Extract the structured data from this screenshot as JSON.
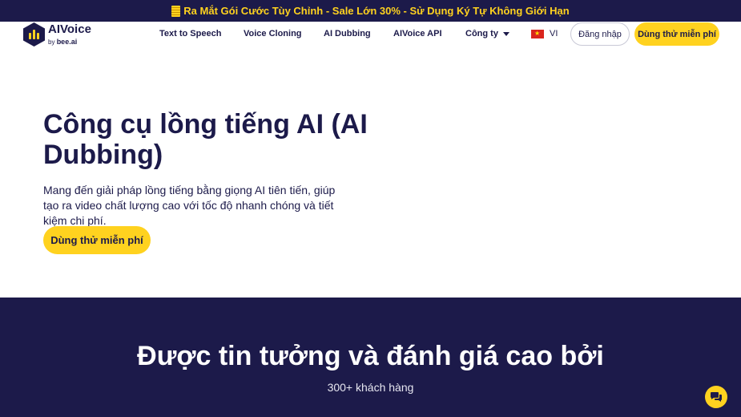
{
  "promo": {
    "text": "Ra Mắt Gói Cước Tùy Chỉnh - Sale Lớn 30% - Sử Dụng Ký Tự Không Giới Hạn"
  },
  "header": {
    "logo": {
      "brand": "AIVoice",
      "by": "by",
      "partner": "bee.ai"
    },
    "nav": [
      {
        "label": "Text to Speech"
      },
      {
        "label": "Voice Cloning"
      },
      {
        "label": "AI Dubbing"
      },
      {
        "label": "AIVoice API"
      },
      {
        "label": "Công ty"
      }
    ],
    "language": "VI",
    "login_label": "Đăng nhập",
    "try_label": "Dùng thử miễn phí"
  },
  "hero": {
    "title": "Công cụ lồng tiếng AI (AI Dubbing)",
    "description": "Mang đến giải pháp lồng tiếng bằng giọng AI tiên tiến, giúp tạo ra video chất lượng cao với tốc độ nhanh chóng và tiết kiệm chi phí.",
    "cta_label": "Dùng thử miễn phí"
  },
  "trust": {
    "heading": "Được tin tưởng và đánh giá cao bởi",
    "subheading": "300+ khách hàng"
  },
  "colors": {
    "navy": "#1c1a4a",
    "yellow": "#ffd21f"
  },
  "icons": {
    "promo": "coin-stack-icon",
    "chat": "chat-bubble-icon",
    "language": "vietnam-flag-icon"
  }
}
